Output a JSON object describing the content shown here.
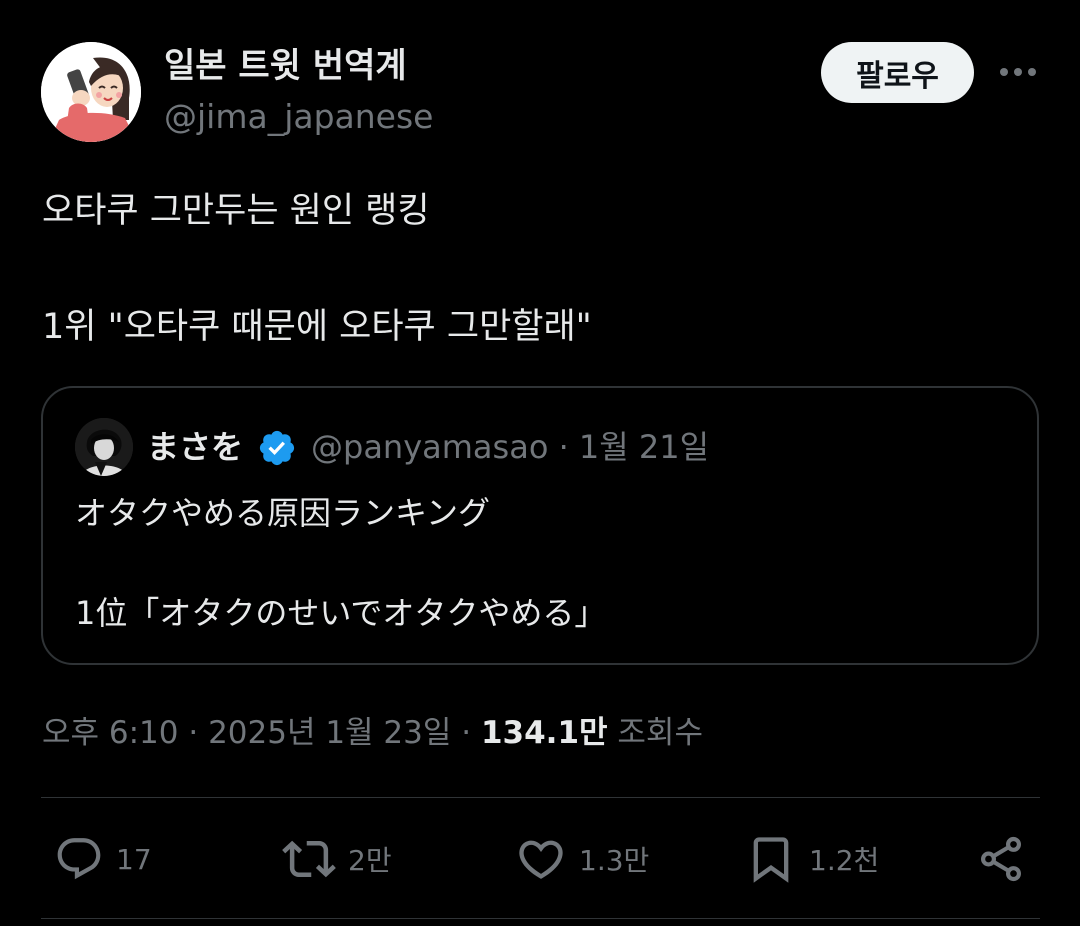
{
  "author": {
    "display_name": "일본 트윗 번역계",
    "handle": "@jima_japanese",
    "avatar_icon": "avatar-illustration-icon"
  },
  "follow_label": "팔로우",
  "more_icon": "more-horizontal-icon",
  "tweet": {
    "line1": "오타쿠 그만두는 원인 랭킹",
    "line2": "1위 \"오타쿠 때문에 오타쿠 그만할래\""
  },
  "quote": {
    "display_name": "まさを",
    "verified_icon": "verified-badge-icon",
    "meta": "@panyamasao · 1월 21일",
    "line1": "オタクやめる原因ランキング",
    "line2": "1位「オタクのせいでオタクやめる」"
  },
  "timestamp": {
    "time_date": "오후 6:10 · 2025년 1월 23일 · ",
    "views_count": "134.1만",
    "views_label": " 조회수"
  },
  "actions": {
    "reply": {
      "icon": "reply-icon",
      "count": "17"
    },
    "retweet": {
      "icon": "retweet-icon",
      "count": "2만"
    },
    "like": {
      "icon": "heart-icon",
      "count": "1.3만"
    },
    "bookmark": {
      "icon": "bookmark-icon",
      "count": "1.2천"
    },
    "share": {
      "icon": "share-icon"
    }
  },
  "colors": {
    "background": "#000000",
    "text": "#e7e9ea",
    "secondary": "#71767b",
    "border": "#2f3336",
    "verified": "#1d9bf0",
    "follow_bg": "#eff3f4"
  }
}
